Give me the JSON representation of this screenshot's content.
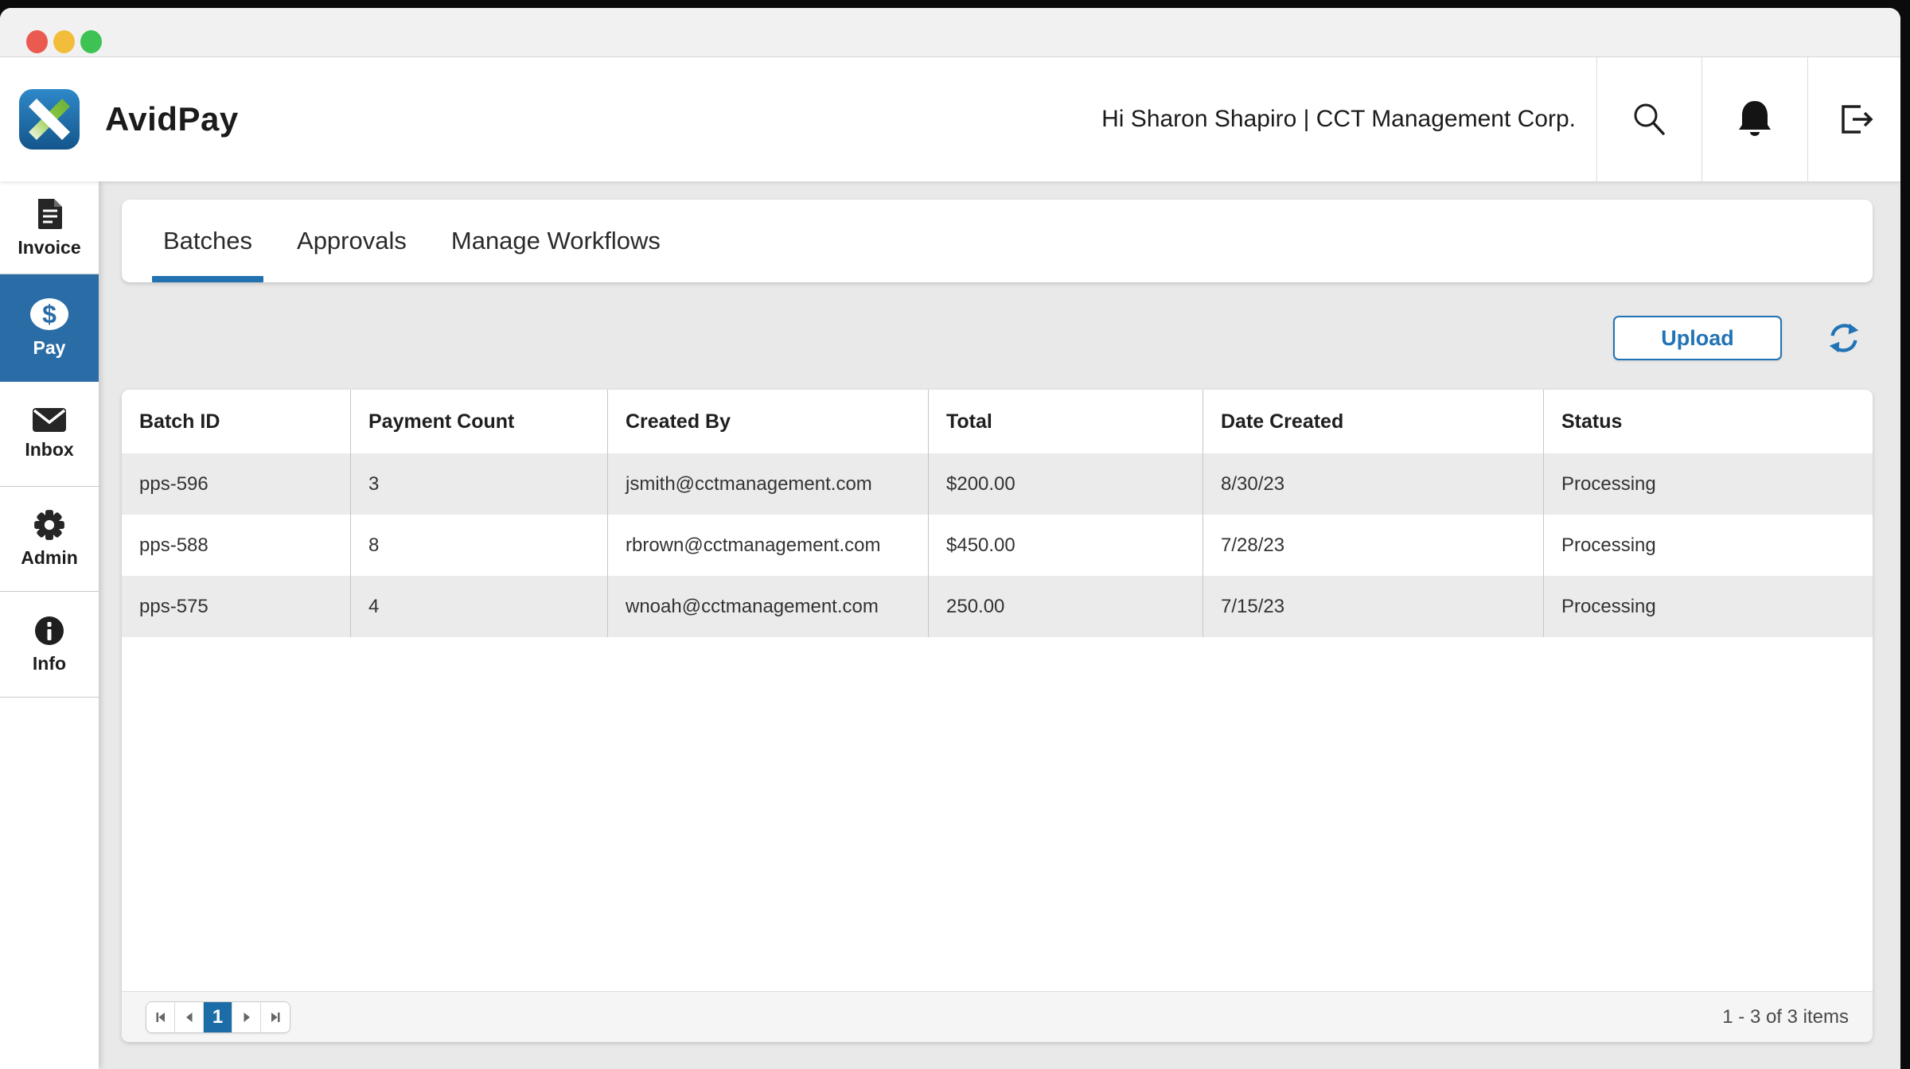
{
  "header": {
    "app_name": "AvidPay",
    "greeting": "Hi Sharon Shapiro |  CCT Management Corp.",
    "icons": [
      "search-icon",
      "bell-icon",
      "logout-icon"
    ]
  },
  "titlebar": {
    "traffic_lights": [
      "close",
      "minimize",
      "zoom"
    ]
  },
  "sidebar": {
    "items": [
      {
        "label": "Invoice",
        "icon": "invoice-document-icon",
        "active": false
      },
      {
        "label": "Pay",
        "icon": "dollar-circle-icon",
        "active": true
      },
      {
        "label": "Inbox",
        "icon": "envelope-icon",
        "active": false
      },
      {
        "label": "Admin",
        "icon": "gear-icon",
        "active": false
      },
      {
        "label": "Info",
        "icon": "info-circle-icon",
        "active": false
      }
    ]
  },
  "tabs": [
    {
      "label": "Batches",
      "active": true
    },
    {
      "label": "Approvals",
      "active": false
    },
    {
      "label": "Manage Workflows",
      "active": false
    }
  ],
  "toolbar": {
    "upload_label": "Upload",
    "refresh_icon": "refresh-icon"
  },
  "table": {
    "columns": [
      "Batch ID",
      "Payment Count",
      "Created By",
      "Total",
      "Date Created",
      "Status"
    ],
    "rows": [
      [
        "pps-596",
        "3",
        "jsmith@cctmanagement.com",
        "$200.00",
        "8/30/23",
        "Processing"
      ],
      [
        "pps-588",
        "8",
        "rbrown@cctmanagement.com",
        "$450.00",
        "7/28/23",
        "Processing"
      ],
      [
        "pps-575",
        "4",
        "wnoah@cctmanagement.com",
        "250.00",
        "7/15/23",
        "Processing"
      ]
    ]
  },
  "pagination": {
    "current_page": "1",
    "summary": "1 - 3 of 3 items",
    "buttons": [
      "first-page-icon",
      "prev-page-icon",
      "next-page-icon",
      "last-page-icon"
    ]
  },
  "colors": {
    "accent_blue": "#2173b5",
    "sidebar_active_blue": "#2a6da6",
    "pager_active_blue": "#1c6ca8",
    "logo_green": "#8dc63f",
    "logo_blue": "#2780bf",
    "traffic_red": "#ea5a50",
    "traffic_yellow": "#f3bd3c",
    "traffic_green": "#3ec254"
  }
}
